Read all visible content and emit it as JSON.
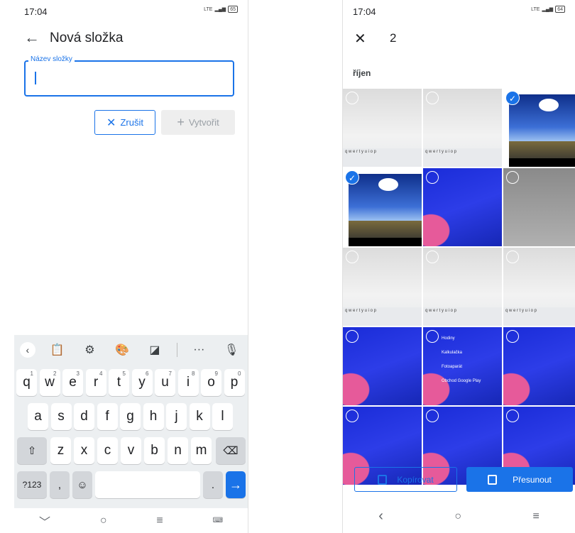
{
  "left": {
    "status": {
      "time": "17:04",
      "network": "LTE",
      "battery": "65"
    },
    "title": "Nová složka",
    "field": {
      "label": "Název složky",
      "value": ""
    },
    "cancel_label": "Zrušit",
    "create_label": "Vytvořit",
    "keyboard": {
      "row1": [
        "q",
        "w",
        "e",
        "r",
        "t",
        "y",
        "u",
        "i",
        "o",
        "p"
      ],
      "row1_hints": [
        "1",
        "2",
        "3",
        "4",
        "5",
        "6",
        "7",
        "8",
        "9",
        "0"
      ],
      "row2": [
        "a",
        "s",
        "d",
        "f",
        "g",
        "h",
        "j",
        "k",
        "l"
      ],
      "row3": [
        "z",
        "x",
        "c",
        "v",
        "b",
        "n",
        "m"
      ],
      "symbols_key": "?123",
      "comma_key": ",",
      "period_key": "."
    }
  },
  "right": {
    "status": {
      "time": "17:04",
      "network": "LTE",
      "battery": "64"
    },
    "selected_count": "2",
    "section_label": "říjen",
    "tiles": [
      {
        "kind": "screen",
        "selected": false
      },
      {
        "kind": "screen",
        "selected": false
      },
      {
        "kind": "photo",
        "selected": true
      },
      {
        "kind": "photo",
        "selected": true
      },
      {
        "kind": "collage",
        "selected": false
      },
      {
        "kind": "gray",
        "selected": false
      },
      {
        "kind": "screen",
        "selected": false
      },
      {
        "kind": "screen",
        "selected": false
      },
      {
        "kind": "screen",
        "selected": false
      },
      {
        "kind": "blue",
        "selected": false
      },
      {
        "kind": "blue",
        "selected": false
      },
      {
        "kind": "blue",
        "selected": false
      },
      {
        "kind": "blue",
        "selected": false
      },
      {
        "kind": "blue",
        "selected": false
      },
      {
        "kind": "blue",
        "selected": false
      }
    ],
    "app_list": [
      "Hodiny",
      "Kalkulačka",
      "Fotoaparát",
      "Obchod Google Play"
    ],
    "copy_label": "Kopírovat",
    "move_label": "Přesunout"
  }
}
